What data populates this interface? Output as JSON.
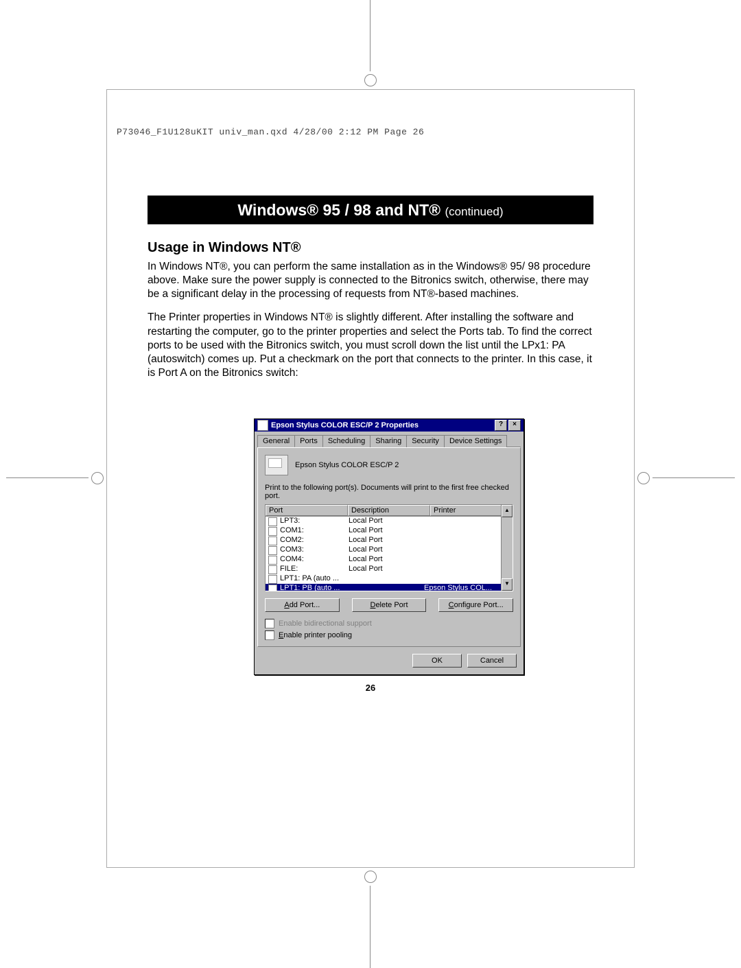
{
  "header_line": "P73046_F1U128uKIT univ_man.qxd  4/28/00  2:12 PM  Page 26",
  "title": {
    "main": "Windows® 95 / 98 and NT®",
    "cont": "(continued)"
  },
  "subhead": "Usage in Windows NT®",
  "para1": "In Windows NT®, you can perform the same installation as in the Windows® 95/ 98 procedure above. Make sure the power supply is connected to the Bitronics switch, otherwise, there may be a significant delay in the processing of requests from NT®-based machines.",
  "para2": "The Printer properties in Windows NT® is slightly different. After installing the software and restarting the computer, go to the printer properties and select the Ports tab. To find the correct ports to be used with the Bitronics switch, you must scroll down the list until the LPx1: PA (autoswitch) comes up. Put a checkmark on the port that connects to the printer. In this case, it is Port A on the Bitronics switch:",
  "dialog": {
    "title": "Epson Stylus COLOR ESC/P 2 Properties",
    "tabs": [
      "General",
      "Ports",
      "Scheduling",
      "Sharing",
      "Security",
      "Device Settings"
    ],
    "active_tab": 1,
    "printer_name": "Epson Stylus COLOR ESC/P 2",
    "instruction": "Print to the following port(s). Documents will print to the first free checked port.",
    "columns": {
      "port": "Port",
      "desc": "Description",
      "printer": "Printer"
    },
    "rows": [
      {
        "checked": false,
        "port": "LPT3:",
        "desc": "Local Port",
        "printer": ""
      },
      {
        "checked": false,
        "port": "COM1:",
        "desc": "Local Port",
        "printer": ""
      },
      {
        "checked": false,
        "port": "COM2:",
        "desc": "Local Port",
        "printer": ""
      },
      {
        "checked": false,
        "port": "COM3:",
        "desc": "Local Port",
        "printer": ""
      },
      {
        "checked": false,
        "port": "COM4:",
        "desc": "Local Port",
        "printer": ""
      },
      {
        "checked": false,
        "port": "FILE:",
        "desc": "Local Port",
        "printer": ""
      },
      {
        "checked": false,
        "port": "LPT1:  PA (auto ...",
        "desc": "",
        "printer": ""
      },
      {
        "checked": true,
        "port": "LPT1:  PB (auto ...",
        "desc": "",
        "printer": "Epson Stylus COL...",
        "selected": true
      }
    ],
    "buttons": {
      "add": "Add Port...",
      "delete": "Delete Port",
      "configure": "Configure Port..."
    },
    "chk_bidi": "Enable bidirectional support",
    "chk_pool": "Enable printer pooling",
    "ok": "OK",
    "cancel": "Cancel"
  },
  "page_number": "26"
}
